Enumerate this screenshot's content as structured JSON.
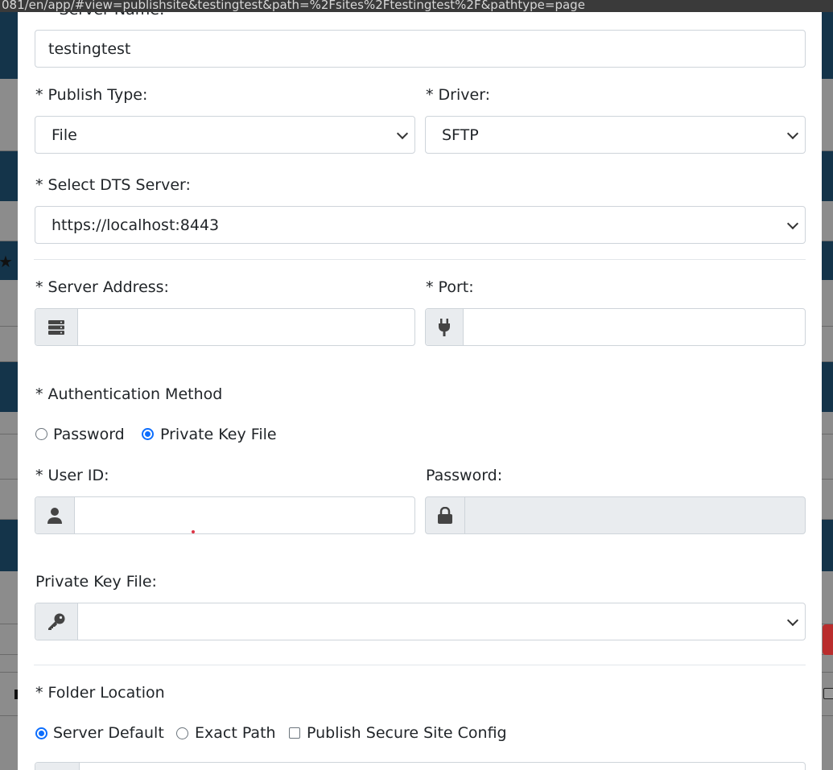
{
  "browser": {
    "url_fragment": "081/en/app/#view=publishsite&testingtest&path=%2Fsites%2Ftestingtest%2F&pathtype=page"
  },
  "form": {
    "server_name_label": "* Server Name:",
    "server_name_value": "testingtest",
    "publish_type_label": "* Publish Type:",
    "publish_type_value": "File",
    "driver_label": "* Driver:",
    "driver_value": "SFTP",
    "dts_server_label": "* Select DTS Server:",
    "dts_server_value": "https://localhost:8443",
    "server_address_label": "* Server Address:",
    "server_address_value": "",
    "port_label": "* Port:",
    "port_value": "",
    "auth_method_label": "* Authentication Method",
    "auth_option_password": "Password",
    "auth_option_private_key": "Private Key File",
    "auth_selected": "Private Key File",
    "user_id_label": "* User ID:",
    "user_id_value": "",
    "password_label": "Password:",
    "password_value": "",
    "private_key_label": "Private Key File:",
    "private_key_value": "",
    "folder_location_label": "* Folder Location",
    "folder_option_server_default": "Server Default",
    "folder_option_exact_path": "Exact Path",
    "folder_selected": "Server Default",
    "publish_secure_label": "Publish Secure Site Config",
    "publish_secure_checked": false
  },
  "icons": {
    "server_address": "server-icon",
    "port": "plug-icon",
    "user_id": "user-icon",
    "password": "lock-icon",
    "private_key": "key-icon"
  },
  "colors": {
    "primary": "#0d6efd",
    "addon_bg": "#e9ecef",
    "border": "#ced4da",
    "background_dark": "#14344a"
  }
}
